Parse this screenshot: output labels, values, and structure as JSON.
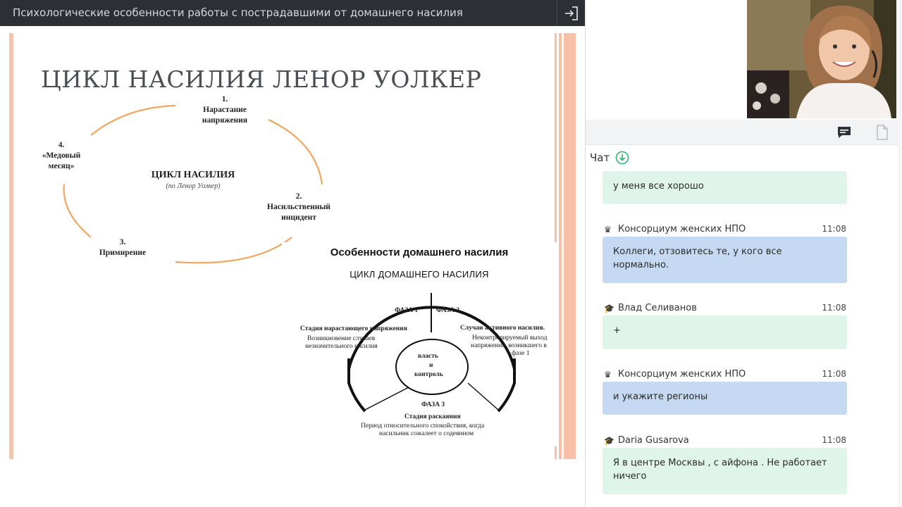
{
  "header": {
    "title": "Психологические особенности работы с пострадавшими от домашнего насилия"
  },
  "slide": {
    "title": "ЦИКЛ НАСИЛИЯ  ЛЕНОР УОЛКЕР",
    "cycle": {
      "center_title": "ЦИКЛ НАСИЛИЯ",
      "center_sub": "(по Ленор Уолкер)",
      "stage1_num": "1.",
      "stage1_a": "Нарастание",
      "stage1_b": "напряжения",
      "stage2_num": "2.",
      "stage2_a": "Насильственный",
      "stage2_b": "инцидент",
      "stage3_num": "3.",
      "stage3_a": "Примирение",
      "stage4_num": "4.",
      "stage4_a": "«Медовый",
      "stage4_b": "месяц»"
    },
    "domestic": {
      "title": "Особенности домашнего насилия",
      "subtitle": "ЦИКЛ ДОМАШНЕГО НАСИЛИЯ",
      "phase1": "ФАЗА 1",
      "phase2": "ФАЗА 2",
      "phase3": "ФАЗА 3",
      "left_title": "Стадия нарастающего напряжения",
      "left_a": "Возникновение случаев",
      "left_b": "незначительного насилия",
      "right_title": "Случаи активного насилия.",
      "right_a": "Неконтролируемый выход",
      "right_b": "напряжения, возникшего в",
      "right_c": "фазе 1",
      "center_a": "власть",
      "center_b": "и",
      "center_c": "контроль",
      "bottom_title": "Стадия раскаяния",
      "bottom_a": "Период относительного спокойствия, когда",
      "bottom_b": "насильник сожалеет о содеянном"
    }
  },
  "chat": {
    "title": "Чат",
    "messages": [
      {
        "author": "",
        "time": "",
        "text": "у меня все хорошо",
        "style": "green"
      },
      {
        "author": "Консорциум женских НПО",
        "time": "11:08",
        "text": "Коллеги, отзовитесь те, у кого все нормально.",
        "style": "blue",
        "role": "crown-icon"
      },
      {
        "author": "Влад Селиванов",
        "time": "11:08",
        "text": "+",
        "style": "green",
        "role": "graduation-cap-icon"
      },
      {
        "author": "Консорциум женских НПО",
        "time": "11:08",
        "text": "и укажите регионы",
        "style": "blue",
        "role": "crown-icon"
      },
      {
        "author": "Daria Gusarova",
        "time": "11:08",
        "text": "Я в центре Москвы , с айфона . Не работает ничего",
        "style": "green",
        "role": "graduation-cap-icon"
      }
    ]
  },
  "colors": {
    "topbar": "#2c2f33",
    "slide_accent": "#f5c4ad",
    "arc_orange": "#f2a65e",
    "bubble_green": "#dff5ea",
    "bubble_blue": "#c5daf2",
    "chat_download": "#2bb673"
  }
}
